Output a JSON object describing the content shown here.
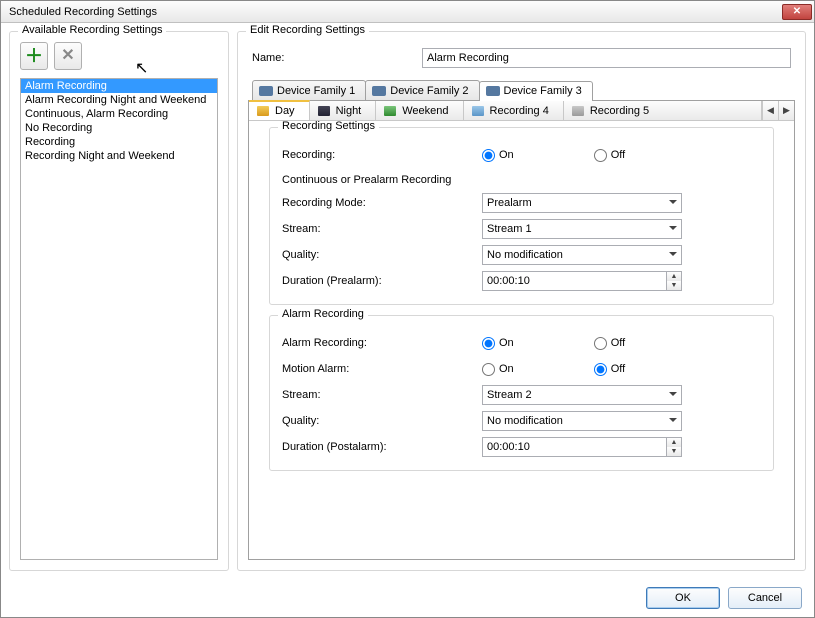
{
  "window": {
    "title": "Scheduled Recording Settings"
  },
  "left": {
    "legend": "Available Recording Settings",
    "items": [
      "Alarm Recording",
      "Alarm Recording Night and Weekend",
      "Continuous, Alarm Recording",
      "No Recording",
      "Recording",
      "Recording Night and Weekend"
    ],
    "selected_index": 0
  },
  "right": {
    "legend": "Edit Recording Settings",
    "name_label": "Name:",
    "name_value": "Alarm Recording",
    "family_tabs": [
      "Device Family 1",
      "Device Family 2",
      "Device Family 3"
    ],
    "family_active": 2,
    "day_tabs": [
      "Day",
      "Night",
      "Weekend",
      "Recording 4",
      "Recording 5"
    ],
    "day_active": 0,
    "rec_settings": {
      "legend": "Recording Settings",
      "recording_label": "Recording:",
      "on_label": "On",
      "off_label": "Off",
      "recording_value": "On",
      "cont_header": "Continuous or Prealarm Recording",
      "mode_label": "Recording Mode:",
      "mode_value": "Prealarm",
      "stream_label": "Stream:",
      "stream_value": "Stream 1",
      "quality_label": "Quality:",
      "quality_value": "No modification",
      "duration_label": "Duration (Prealarm):",
      "duration_value": "00:00:10"
    },
    "alarm_rec": {
      "legend": "Alarm Recording",
      "alarm_label": "Alarm Recording:",
      "alarm_value": "On",
      "motion_label": "Motion Alarm:",
      "motion_value": "Off",
      "on_label": "On",
      "off_label": "Off",
      "stream_label": "Stream:",
      "stream_value": "Stream 2",
      "quality_label": "Quality:",
      "quality_value": "No modification",
      "duration_label": "Duration (Postalarm):",
      "duration_value": "00:00:10"
    }
  },
  "footer": {
    "ok": "OK",
    "cancel": "Cancel"
  }
}
